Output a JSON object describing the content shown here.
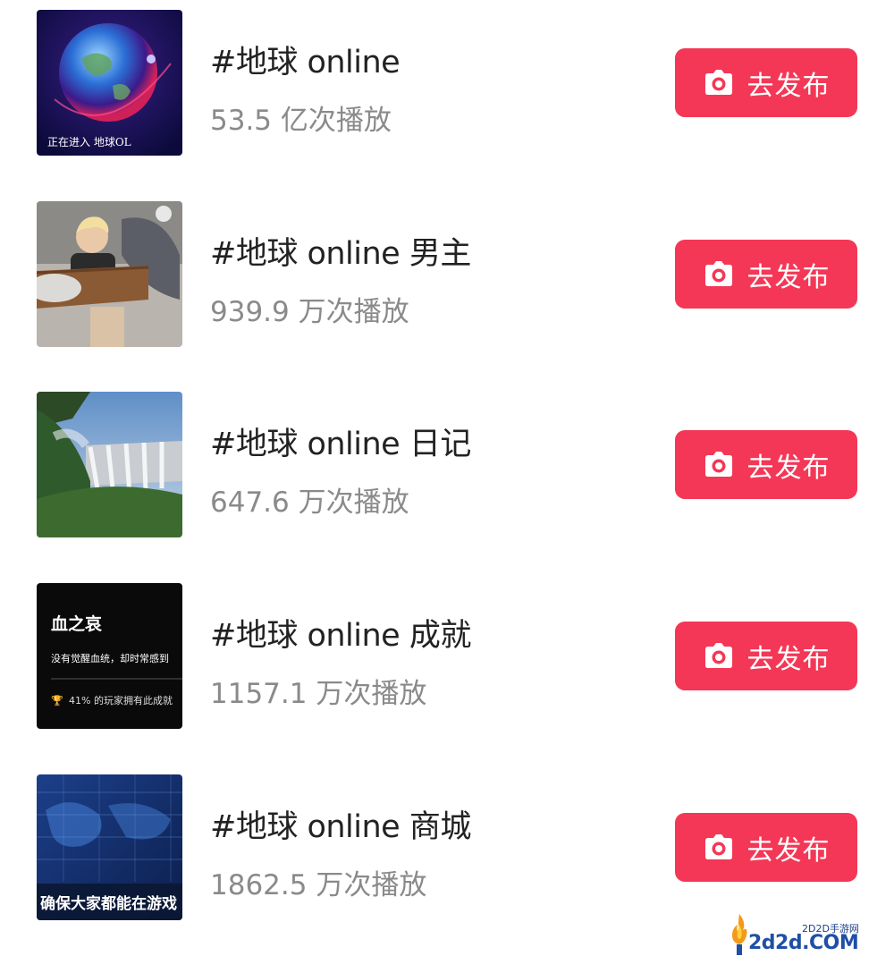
{
  "colors": {
    "accent": "#f43756",
    "title": "#222222",
    "meta": "#8a8a8a"
  },
  "items": [
    {
      "title": "#地球 online",
      "plays": "53.5 亿次播放",
      "button_label": "去发布",
      "button_icon": "camera-icon",
      "thumb_text": "正在进入  地球OL"
    },
    {
      "title": "#地球 online 男主",
      "plays": "939.9 万次播放",
      "button_label": "去发布",
      "button_icon": "camera-icon"
    },
    {
      "title": "#地球 online 日记",
      "plays": "647.6 万次播放",
      "button_label": "去发布",
      "button_icon": "camera-icon"
    },
    {
      "title": "#地球 online 成就",
      "plays": "1157.1 万次播放",
      "button_label": "去发布",
      "button_icon": "camera-icon",
      "thumb_heading": "血之哀",
      "thumb_line": "没有觉醒血统，却时常感到",
      "thumb_stat": "41% 的玩家拥有此成就"
    },
    {
      "title": "#地球 online 商城",
      "plays": "1862.5 万次播放",
      "button_label": "去发布",
      "button_icon": "camera-icon",
      "thumb_caption": "确保大家都能在游戏"
    }
  ],
  "watermark": {
    "site_text": "2D2D手游网",
    "domain": "2d2d.COM"
  }
}
